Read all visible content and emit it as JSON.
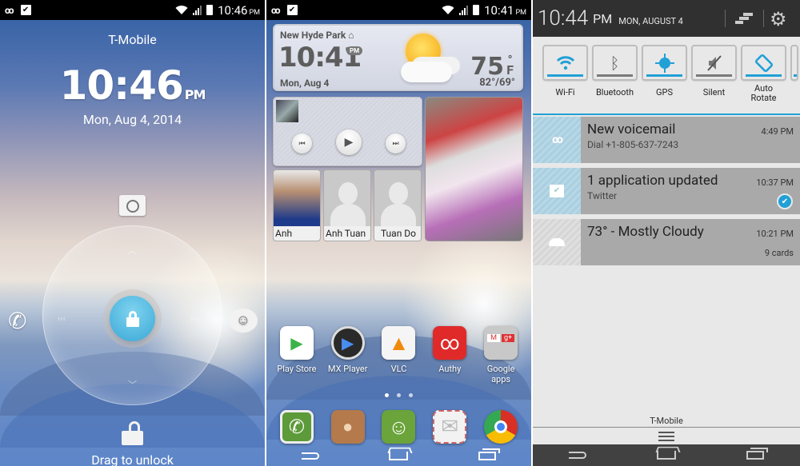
{
  "lockscreen": {
    "status": {
      "time": "10:46",
      "ampm": "PM",
      "icons": [
        "voicemail-icon",
        "store-bag-icon",
        "wifi-icon",
        "signal-icon",
        "battery-icon"
      ]
    },
    "carrier": "T-Mobile",
    "clock": {
      "time": "10:46",
      "ampm": "PM"
    },
    "date": "Mon, Aug 4, 2014",
    "shortcuts": {
      "top": "camera",
      "left": "phone",
      "right": "messaging",
      "bottom": "unlock"
    },
    "hint_up": "︿",
    "hint_down": "﹀",
    "hint_left": "‹‹‹",
    "hint_right": "›››",
    "unlock_label": "Drag to unlock",
    "accent": "#3aa8d6"
  },
  "homescreen": {
    "status": {
      "time": "10:41",
      "ampm": "PM"
    },
    "weather_widget": {
      "location": "New Hyde Park",
      "time": "10:41",
      "ampm": "PM",
      "date": "Mon, Aug 4",
      "temp": "75",
      "unit": "F",
      "hi_lo": "82°/69°",
      "condition_icon": "sun-cloud-icon"
    },
    "music_widget": {
      "prev": "⏮",
      "play": "▶",
      "next": "⏭"
    },
    "contacts": [
      {
        "name": "Anh",
        "has_photo": true
      },
      {
        "name": "Anh Tuan",
        "has_photo": false
      },
      {
        "name": "Tuan Do",
        "has_photo": false
      }
    ],
    "apps": [
      {
        "label": "Play Store",
        "icon": "play-store-icon",
        "color": "#ffffff",
        "glyph": "▶"
      },
      {
        "label": "MX Player",
        "icon": "mx-player-icon",
        "color": "#2a2a2a",
        "glyph": "▶"
      },
      {
        "label": "VLC",
        "icon": "vlc-icon",
        "color": "#f5f5f5",
        "glyph": "▲"
      },
      {
        "label": "Authy",
        "icon": "authy-icon",
        "color": "#e02a2a",
        "glyph": "∞"
      },
      {
        "label": "Google apps",
        "icon": "google-apps-folder-icon",
        "color": "#c8c8c8",
        "glyph": "▦"
      }
    ],
    "page_dots": {
      "count": 3,
      "active": 0
    },
    "dock": [
      {
        "label": "Phone",
        "icon": "phone-icon",
        "color": "#5d9a3a",
        "glyph": "✆"
      },
      {
        "label": "Contacts",
        "icon": "contacts-icon",
        "color": "#b47a4c",
        "glyph": "👤"
      },
      {
        "label": "Messaging",
        "icon": "messaging-icon",
        "color": "#6aa43a",
        "glyph": "☺"
      },
      {
        "label": "Email",
        "icon": "email-icon",
        "color": "#f2f2f2",
        "glyph": "✉"
      },
      {
        "label": "Chrome",
        "icon": "chrome-icon",
        "color": "#e8e8e8",
        "glyph": "◉"
      }
    ]
  },
  "shade": {
    "time": "10:44",
    "ampm": "PM",
    "date": "MON, AUGUST 4",
    "toggles": [
      {
        "label": "Wi-Fi",
        "icon": "wifi-icon",
        "on": true
      },
      {
        "label": "Bluetooth",
        "icon": "bluetooth-icon",
        "on": false
      },
      {
        "label": "GPS",
        "icon": "gps-icon",
        "on": true
      },
      {
        "label": "Silent",
        "icon": "silent-icon",
        "on": false
      },
      {
        "label": "Auto\nRotate",
        "icon": "auto-rotate-icon",
        "on": true
      }
    ],
    "notifications": [
      {
        "title": "New voicemail",
        "subtitle": "Dial +1-805-637-7243",
        "time": "4:49 PM",
        "meta": "",
        "icon": "voicemail-icon"
      },
      {
        "title": "1 application updated",
        "subtitle": "Twitter",
        "time": "10:37 PM",
        "meta": "",
        "icon": "store-bag-icon"
      },
      {
        "title": "73° - Mostly Cloudy",
        "subtitle": "",
        "time": "10:21 PM",
        "meta": "9 cards",
        "icon": "cloud-icon"
      }
    ],
    "carrier": "T-Mobile",
    "accent": "#21a0d6"
  }
}
